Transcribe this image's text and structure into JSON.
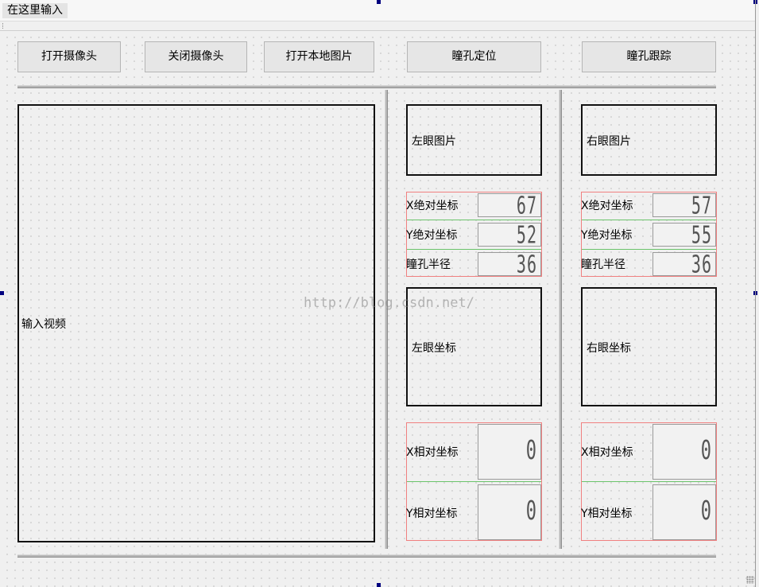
{
  "menubar": {
    "input_placeholder": "在这里输入"
  },
  "toolbar": {
    "open_camera": "打开摄像头",
    "close_camera": "关闭摄像头",
    "open_local_image": "打开本地图片",
    "pupil_locate": "瞳孔定位",
    "pupil_track": "瞳孔跟踪"
  },
  "video": {
    "label": "输入视频"
  },
  "left_eye": {
    "image_label": "左眼图片",
    "x_abs_label": "X绝对坐标",
    "x_abs_value": "67",
    "y_abs_label": "Y绝对坐标",
    "y_abs_value": "52",
    "radius_label": "瞳孔半径",
    "radius_value": "36",
    "coords_label": "左眼坐标",
    "x_rel_label": "X相对坐标",
    "x_rel_value": "0",
    "y_rel_label": "Y相对坐标",
    "y_rel_value": "0"
  },
  "right_eye": {
    "image_label": "右眼图片",
    "x_abs_label": "X绝对坐标",
    "x_abs_value": "57",
    "y_abs_label": "Y绝对坐标",
    "y_abs_value": "55",
    "radius_label": "瞳孔半径",
    "radius_value": "36",
    "coords_label": "右眼坐标",
    "x_rel_label": "X相对坐标",
    "x_rel_value": "0",
    "y_rel_label": "Y相对坐标",
    "y_rel_value": "0"
  },
  "watermark": "http://blog.csdn.net/",
  "colors": {
    "layout_border": "#f08080",
    "layout_row_line": "#6cc46c",
    "selection_handle": "#00007f"
  }
}
